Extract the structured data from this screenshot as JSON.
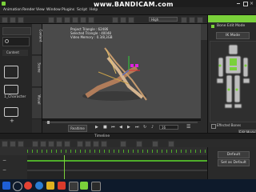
{
  "menu": {
    "items": [
      "Animation",
      "Render",
      "View",
      "Window",
      "Plugins",
      "Script",
      "Help"
    ],
    "recorder": "www.BANDICAM.com"
  },
  "viewport": {
    "info": [
      "Project Triangle : 62486",
      "Selected Triangle : 40048",
      "Video Memory : 0.3/8,3GB"
    ],
    "camera_select": "High"
  },
  "left_panel": {
    "project_label": "Content",
    "item_label": "1_Character"
  },
  "left_tabs": [
    "Content",
    "Scene",
    "Visual"
  ],
  "playbar": {
    "mode": "Realtime",
    "frame": "16"
  },
  "right_panel": {
    "bone_edit_label": "Bone Edit Mode",
    "ik_mode_label": "IK Mode",
    "effector_label": "Effected Bones",
    "default_button": "Default",
    "set_default_button": "Set as Default",
    "edit_button": "Edit Mode"
  },
  "timeline": {
    "title": "Timeline"
  },
  "colors": {
    "accent_green": "#7ad13a",
    "timeline_green": "#4fae2a",
    "taskbar": "#0e1a2b"
  },
  "icons": {
    "search": "search-icon",
    "chrome": "chrome-icon",
    "edge": "edge-icon",
    "explorer": "folder-icon",
    "app": "iclone-icon"
  }
}
